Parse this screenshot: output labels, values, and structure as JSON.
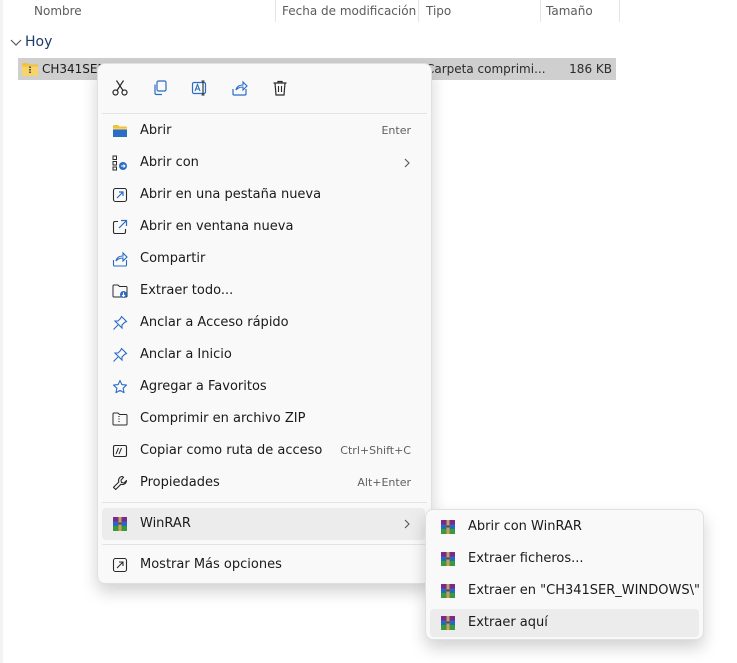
{
  "columns": {
    "name": "Nombre",
    "modified": "Fecha de modificación",
    "type": "Tipo",
    "size": "Tamaño"
  },
  "group": {
    "label": "Hoy"
  },
  "file": {
    "name": "CH341SER",
    "type": "Carpeta comprimi...",
    "size": "186 KB"
  },
  "toolbar": {
    "cut_icon": "scissors-icon",
    "copy_icon": "copy-icon",
    "rename_icon": "rename-icon",
    "share_icon": "share-icon",
    "delete_icon": "trash-icon"
  },
  "menu": {
    "open": {
      "label": "Abrir",
      "shortcut": "Enter"
    },
    "open_with": {
      "label": "Abrir con"
    },
    "open_new_tab": {
      "label": "Abrir en una pestaña nueva"
    },
    "open_new_window": {
      "label": "Abrir en ventana nueva"
    },
    "share": {
      "label": "Compartir"
    },
    "extract_all": {
      "label": "Extraer todo..."
    },
    "pin_quick_access": {
      "label": "Anclar a Acceso rápido"
    },
    "pin_start": {
      "label": "Anclar a Inicio"
    },
    "add_favorites": {
      "label": "Agregar a Favoritos"
    },
    "compress_zip": {
      "label": "Comprimir en archivo ZIP"
    },
    "copy_path": {
      "label": "Copiar como ruta de acceso",
      "shortcut": "Ctrl+Shift+C"
    },
    "properties": {
      "label": "Propiedades",
      "shortcut": "Alt+Enter"
    },
    "winrar": {
      "label": "WinRAR"
    },
    "more_options": {
      "label": "Mostrar Más opciones"
    }
  },
  "submenu": {
    "items": [
      {
        "label": "Abrir con WinRAR"
      },
      {
        "label": "Extraer ficheros..."
      },
      {
        "label": "Extraer en \"CH341SER_WINDOWS\\\""
      },
      {
        "label": "Extraer aquí"
      }
    ]
  },
  "colors": {
    "menu_bg": "#f9f9f9",
    "hover_bg": "#ececec",
    "selected_row": "#cfcfcf",
    "accent_blue": "#2b6cc4",
    "folder_yellow": "#f2c23b"
  }
}
